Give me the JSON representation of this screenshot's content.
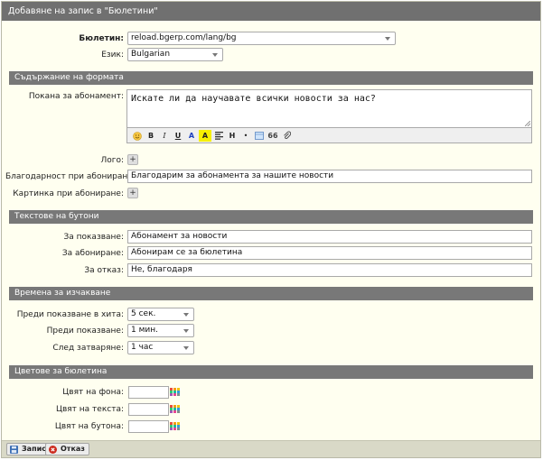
{
  "dialog": {
    "title": "Добавяне на запис в \"Бюлетини\""
  },
  "form": {
    "bulletin_label": "Бюлетин:",
    "bulletin_value": "reload.bgerp.com/lang/bg",
    "language_label": "Език:",
    "language_value": "Bulgarian"
  },
  "sections": {
    "content": "Съдържание на формата",
    "buttons": "Текстове на бутони",
    "timing": "Времена за изчакване",
    "colors": "Цветове за бюлетина"
  },
  "content": {
    "invitation_label": "Покана за абонамент:",
    "invitation_value": "Искате ли да научавате всички новости за нас?",
    "logo_label": "Лого:",
    "thanks_label": "Благодарност при абониране:",
    "thanks_value": "Благодарим за абонамента за нашите новости",
    "image_label": "Картинка при абониране:",
    "add_glyph": "+"
  },
  "editor_toolbar": {
    "bold": "B",
    "italic": "I",
    "underline": "U",
    "color_a": "A",
    "highlight_a": "A",
    "heading": "H",
    "bullet": "•",
    "quote": "66"
  },
  "buttons": {
    "show_label": "За показване:",
    "show_value": "Абонамент за новости",
    "subscribe_label": "За абониране:",
    "subscribe_value": "Абонирам се за бюлетина",
    "decline_label": "За отказ:",
    "decline_value": "Не, благодаря"
  },
  "timing": {
    "before_hit_label": "Преди показване в хита:",
    "before_hit_value": "5 сек.",
    "before_show_label": "Преди показване:",
    "before_show_value": "1 мин.",
    "after_close_label": "След затваряне:",
    "after_close_value": "1 час"
  },
  "colors": {
    "bg_label": "Цвят на фона:",
    "text_label": "Цвят на текста:",
    "button_label": "Цвят на бутона:"
  },
  "footer": {
    "save_label": "Запис",
    "cancel_label": "Отказ"
  },
  "theme": {
    "titlebar": "#707070",
    "section_bar": "#787878",
    "panel_bg": "#fffff0",
    "footer_bg": "#d9d9c7",
    "save_icon": "#3d6fb4",
    "cancel_icon": "#cc2a1e"
  },
  "icons": {
    "select_caret": "chevron-down-icon",
    "color_picker": "palette-icon",
    "save": "save-icon",
    "cancel": "cancel-icon"
  }
}
